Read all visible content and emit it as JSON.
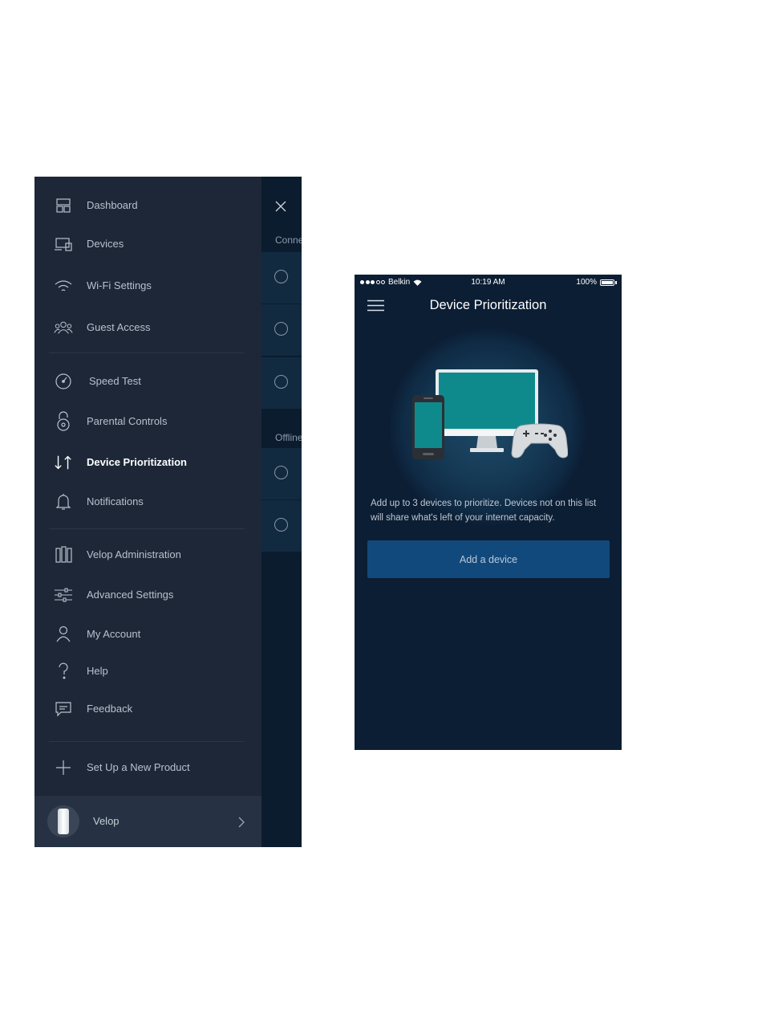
{
  "menu": {
    "items": [
      {
        "key": "dashboard",
        "label": "Dashboard",
        "icon": "dashboard-icon"
      },
      {
        "key": "devices",
        "label": "Devices",
        "icon": "devices-icon"
      },
      {
        "key": "wifi-settings",
        "label": "Wi-Fi Settings",
        "icon": "wifi-icon"
      },
      {
        "key": "guest-access",
        "label": "Guest Access",
        "icon": "guest-access-icon"
      },
      {
        "key": "speed-test",
        "label": "Speed Test",
        "icon": "speedometer-icon"
      },
      {
        "key": "parental-controls",
        "label": "Parental Controls",
        "icon": "lock-icon"
      },
      {
        "key": "device-prioritization",
        "label": "Device Prioritization",
        "icon": "prioritization-arrows-icon"
      },
      {
        "key": "notifications",
        "label": "Notifications",
        "icon": "bell-icon"
      },
      {
        "key": "velop-administration",
        "label": "Velop Administration",
        "icon": "velop-nodes-icon"
      },
      {
        "key": "advanced-settings",
        "label": "Advanced Settings",
        "icon": "sliders-icon"
      },
      {
        "key": "my-account",
        "label": "My Account",
        "icon": "person-icon"
      },
      {
        "key": "help",
        "label": "Help",
        "icon": "question-icon"
      },
      {
        "key": "feedback",
        "label": "Feedback",
        "icon": "chat-bubble-icon"
      },
      {
        "key": "set-up-new-product",
        "label": "Set Up a New Product",
        "icon": "plus-icon"
      }
    ],
    "active_item": "Device Prioritization",
    "footer": {
      "label": "Velop",
      "icon": "velop-node-avatar"
    }
  },
  "background_screen": {
    "section_connected": "Conne",
    "section_offline": "Offline"
  },
  "phone": {
    "status_bar": {
      "carrier": "Belkin",
      "time": "10:19 AM",
      "battery": "100%"
    },
    "title": "Device Prioritization",
    "description": "Add up to 3 devices to prioritize. Devices not on this list will share what's left of your internet capacity.",
    "add_button_label": "Add a device",
    "colors": {
      "background": "#0c1e34",
      "button": "#12497c",
      "screen_teal": "#0f8a8c"
    }
  }
}
